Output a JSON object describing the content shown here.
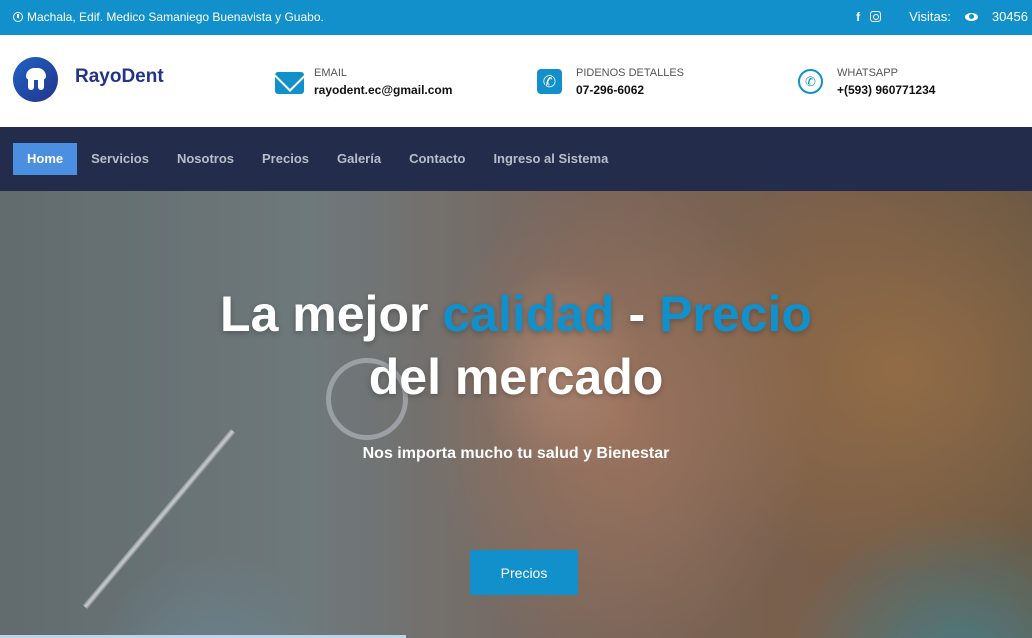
{
  "topbar": {
    "address": "Machala, Edif. Medico Samaniego Buenavista y Guabo.",
    "social": [
      {
        "icon": "facebook-icon",
        "glyph": "f"
      },
      {
        "icon": "instagram-icon"
      }
    ],
    "visits_label": "Visitas:",
    "visits_count": "30456"
  },
  "header": {
    "brand": "RayoDent",
    "email": {
      "label": "EMAIL",
      "value": "rayodent.ec@gmail.com",
      "icon": "envelope-icon"
    },
    "phone": {
      "label": "PIDENOS DETALLES",
      "value": "07-296-6062",
      "icon": "phone-icon"
    },
    "whatsapp": {
      "label": "WHATSAPP",
      "value": "+(593) 960771234",
      "icon": "whatsapp-icon"
    }
  },
  "nav": {
    "items": [
      {
        "label": "Home",
        "active": true
      },
      {
        "label": "Servicios"
      },
      {
        "label": "Nosotros"
      },
      {
        "label": "Precios"
      },
      {
        "label": "Galería"
      },
      {
        "label": "Contacto"
      },
      {
        "label": "Ingreso al Sistema"
      }
    ]
  },
  "hero": {
    "headline_part1": "La mejor ",
    "headline_accent1": "calidad",
    "headline_sep": " - ",
    "headline_accent2": "Precio",
    "headline_line2": "del mercado",
    "subtitle": "Nos importa mucho tu salud y Bienestar",
    "button": "Precios"
  },
  "colors": {
    "primary": "#1190cb",
    "nav_bg": "#232c4a",
    "nav_active": "#4b8fe0",
    "brand": "#24338a"
  }
}
